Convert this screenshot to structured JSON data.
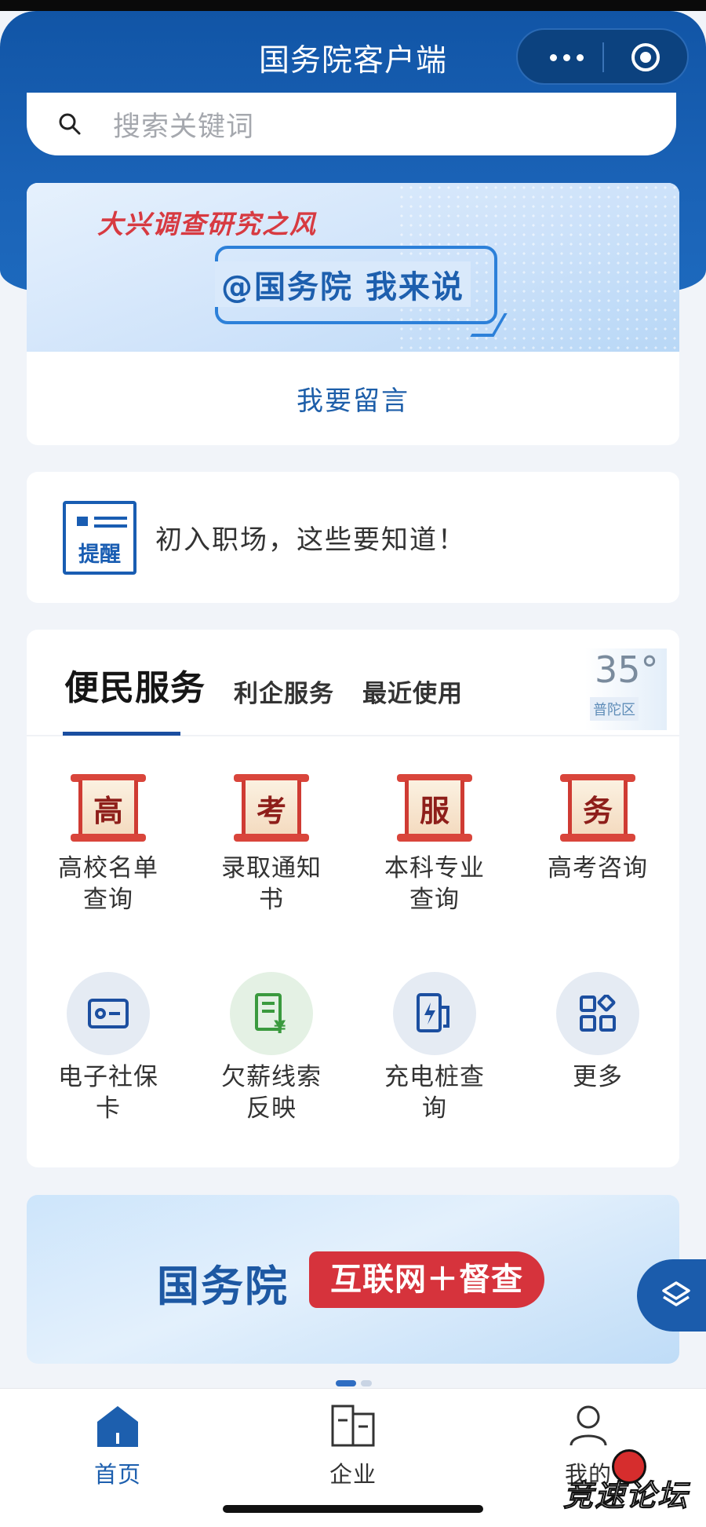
{
  "header": {
    "title": "国务院客户端",
    "more_icon": "more-dots-icon",
    "close_icon": "target-icon"
  },
  "search": {
    "placeholder": "搜索关键词"
  },
  "banner_survey": {
    "headline": "大兴调查研究之风",
    "subline": "@国务院 我来说",
    "action_label": "我要留言"
  },
  "notice": {
    "badge": "提醒",
    "text": "初入职场，这些要知道！"
  },
  "services": {
    "tabs": [
      "便民服务",
      "利企服务",
      "最近使用"
    ],
    "weather": {
      "temp": "35°",
      "district": "普陀区"
    },
    "items_row1": [
      {
        "glyph": "高",
        "label": "高校名单查询"
      },
      {
        "glyph": "考",
        "label": "录取通知书"
      },
      {
        "glyph": "服",
        "label": "本科专业查询"
      },
      {
        "glyph": "务",
        "label": "高考咨询"
      }
    ],
    "items_row2": [
      {
        "icon": "social-security-card-icon",
        "label": "电子社保卡"
      },
      {
        "icon": "wage-report-icon",
        "label": "欠薪线索反映"
      },
      {
        "icon": "charging-pile-icon",
        "label": "充电桩查询"
      },
      {
        "icon": "grid-more-icon",
        "label": "更多"
      }
    ]
  },
  "banner_inspect": {
    "left_text": "国务院",
    "pill_text": "互联网＋督查",
    "carousel": {
      "count": 2,
      "active": 1
    }
  },
  "tabbar": {
    "items": [
      {
        "label": "首页",
        "icon": "home-icon",
        "active": true
      },
      {
        "label": "企业",
        "icon": "building-icon",
        "active": false
      },
      {
        "label": "我的",
        "icon": "person-icon",
        "active": false
      }
    ]
  },
  "watermark": {
    "text": "竞速论坛"
  },
  "colors": {
    "brand_blue": "#1155a6",
    "accent_red": "#d6333c",
    "page_bg": "#f1f4f9"
  }
}
